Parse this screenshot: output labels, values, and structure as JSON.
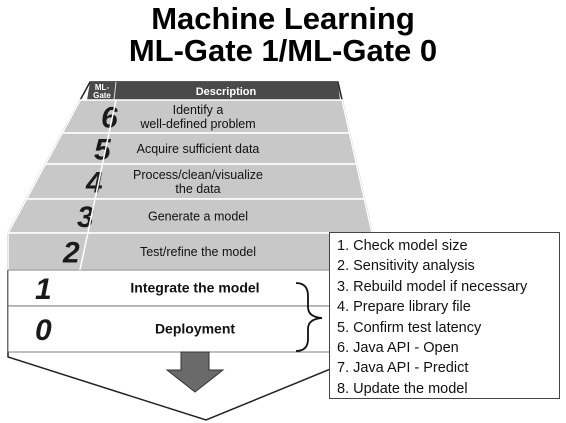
{
  "title": {
    "line1": "Machine Learning",
    "line2": "ML-Gate 1/ML-Gate 0"
  },
  "table_header": {
    "gate_line1": "ML-",
    "gate_line2": "Gate",
    "description": "Description"
  },
  "gates": [
    {
      "number": "6",
      "lines": [
        "Identify a",
        "well-defined problem"
      ],
      "shaded": true
    },
    {
      "number": "5",
      "lines": [
        "Acquire sufficient data"
      ],
      "shaded": true
    },
    {
      "number": "4",
      "lines": [
        "Process/clean/visualize",
        "the data"
      ],
      "shaded": true
    },
    {
      "number": "3",
      "lines": [
        "Generate a model"
      ],
      "shaded": true
    },
    {
      "number": "2",
      "lines": [
        "Test/refine the model"
      ],
      "shaded": true
    },
    {
      "number": "1",
      "lines": [
        "Integrate the model"
      ],
      "shaded": false
    },
    {
      "number": "0",
      "lines": [
        "Deployment"
      ],
      "shaded": false
    }
  ],
  "integration_steps": [
    "1. Check model size",
    "2. Sensitivity analysis",
    "3. Rebuild model if necessary",
    "4. Prepare library file",
    "5. Confirm test latency",
    "6. Java API - Open",
    "7. Java API - Predict",
    "8. Update the model"
  ],
  "colors": {
    "header_band": "#4a4a4a",
    "shaded_row": "#c8c8c8",
    "border": "#222222",
    "arrow": "#6a6a6a"
  },
  "icons": [
    "down-arrow-icon",
    "curly-brace-icon"
  ]
}
